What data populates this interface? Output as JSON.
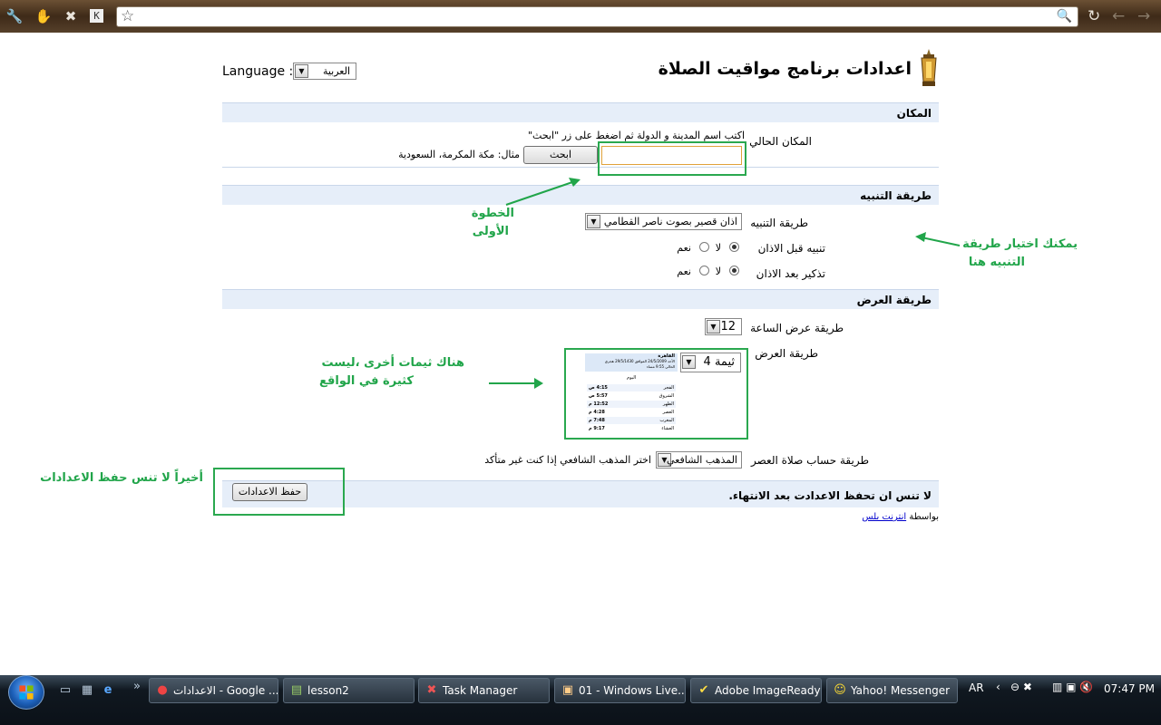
{
  "browser": {
    "toolbar_icons": [
      "wrench-icon",
      "extension-icon",
      "task-manager-icon",
      "k-icon"
    ],
    "omnibox_value": ""
  },
  "page": {
    "title": "اعدادات برنامج مواقيت الصلاة",
    "language_label": "Language :",
    "language_value": "العربية",
    "sections": {
      "location": "المكان",
      "alert": "طريقة التنبيه",
      "display": "طريقة العرض"
    },
    "location": {
      "current_label": "المكان الحالي",
      "instruction": "اكتب اسم المدينة و الدولة ثم اضغط على زر \"ابحث\"",
      "city_value": "",
      "search_button": "ابحث",
      "example": "مثال: مكة المكرمة، السعودية"
    },
    "alert": {
      "method_label": "طريقة التنبيه",
      "method_value": "اذان قصير بصوت ناصر القطامي",
      "before_label": "تنبيه قبل الاذان",
      "after_label": "تذكير بعد الاذان",
      "no": "لا",
      "yes": "نعم"
    },
    "display": {
      "clock_label": "طريقة عرض الساعة",
      "clock_value": "12",
      "theme_label": "طريقة العرض",
      "theme_value": "ثيمة 4",
      "asr_label": "طريقة حساب صلاة العصر",
      "asr_value": "المذهب الشافعي",
      "asr_hint": "اختر المذهب الشافعي إذا كنت غير متأكد"
    },
    "save": {
      "reminder": "لا تنس ان تحفظ الاعدادت بعد الانتهاء.",
      "button": "حفظ الاعدادات"
    },
    "footer": {
      "by": "بواسطة",
      "link": "انترنت بلس"
    },
    "preview": {
      "city": "القاهرة",
      "line1": "الأحد 24/5/2009 الموافق 29/5/1430 هجري",
      "line2": "الحالي 9:55 مساء",
      "today": "اليوم",
      "prayers": [
        {
          "name": "الفجر",
          "time": "4:15 ص"
        },
        {
          "name": "الشروق",
          "time": "5:57 ص"
        },
        {
          "name": "الظهر",
          "time": "12:52 م"
        },
        {
          "name": "العصر",
          "time": "4:28 م"
        },
        {
          "name": "المغرب",
          "time": "7:48 م"
        },
        {
          "name": "العشاء",
          "time": "9:17 م"
        }
      ]
    }
  },
  "annotations": {
    "step1_line1": "الخطوة",
    "step1_line2": "الأولى",
    "alert_line1": "يمكنك اختيار طريقة",
    "alert_line2": "التنبيه هنا",
    "themes_line1": "هناك ثيمات أخرى ،ليست",
    "themes_line2": "كثيرة في الواقع",
    "save_note": "أخيراً لا تنس حفظ الاعدادات"
  },
  "taskbar": {
    "tasks": [
      {
        "label": "الاعدادات - Google ...",
        "icon": "chrome-icon"
      },
      {
        "label": "lesson2",
        "icon": "notepad-icon"
      },
      {
        "label": "Task Manager",
        "icon": "task-manager-icon"
      },
      {
        "label": "01 - Windows Live...",
        "icon": "windows-live-icon"
      },
      {
        "label": "Adobe ImageReady",
        "icon": "imageready-icon"
      },
      {
        "label": "Yahoo! Messenger",
        "icon": "yahoo-icon"
      }
    ],
    "language": "AR",
    "clock": "07:47 PM"
  },
  "colors": {
    "accent_green": "#21a54a",
    "section_blue": "#e6eef9",
    "link_blue": "#0000cc"
  }
}
